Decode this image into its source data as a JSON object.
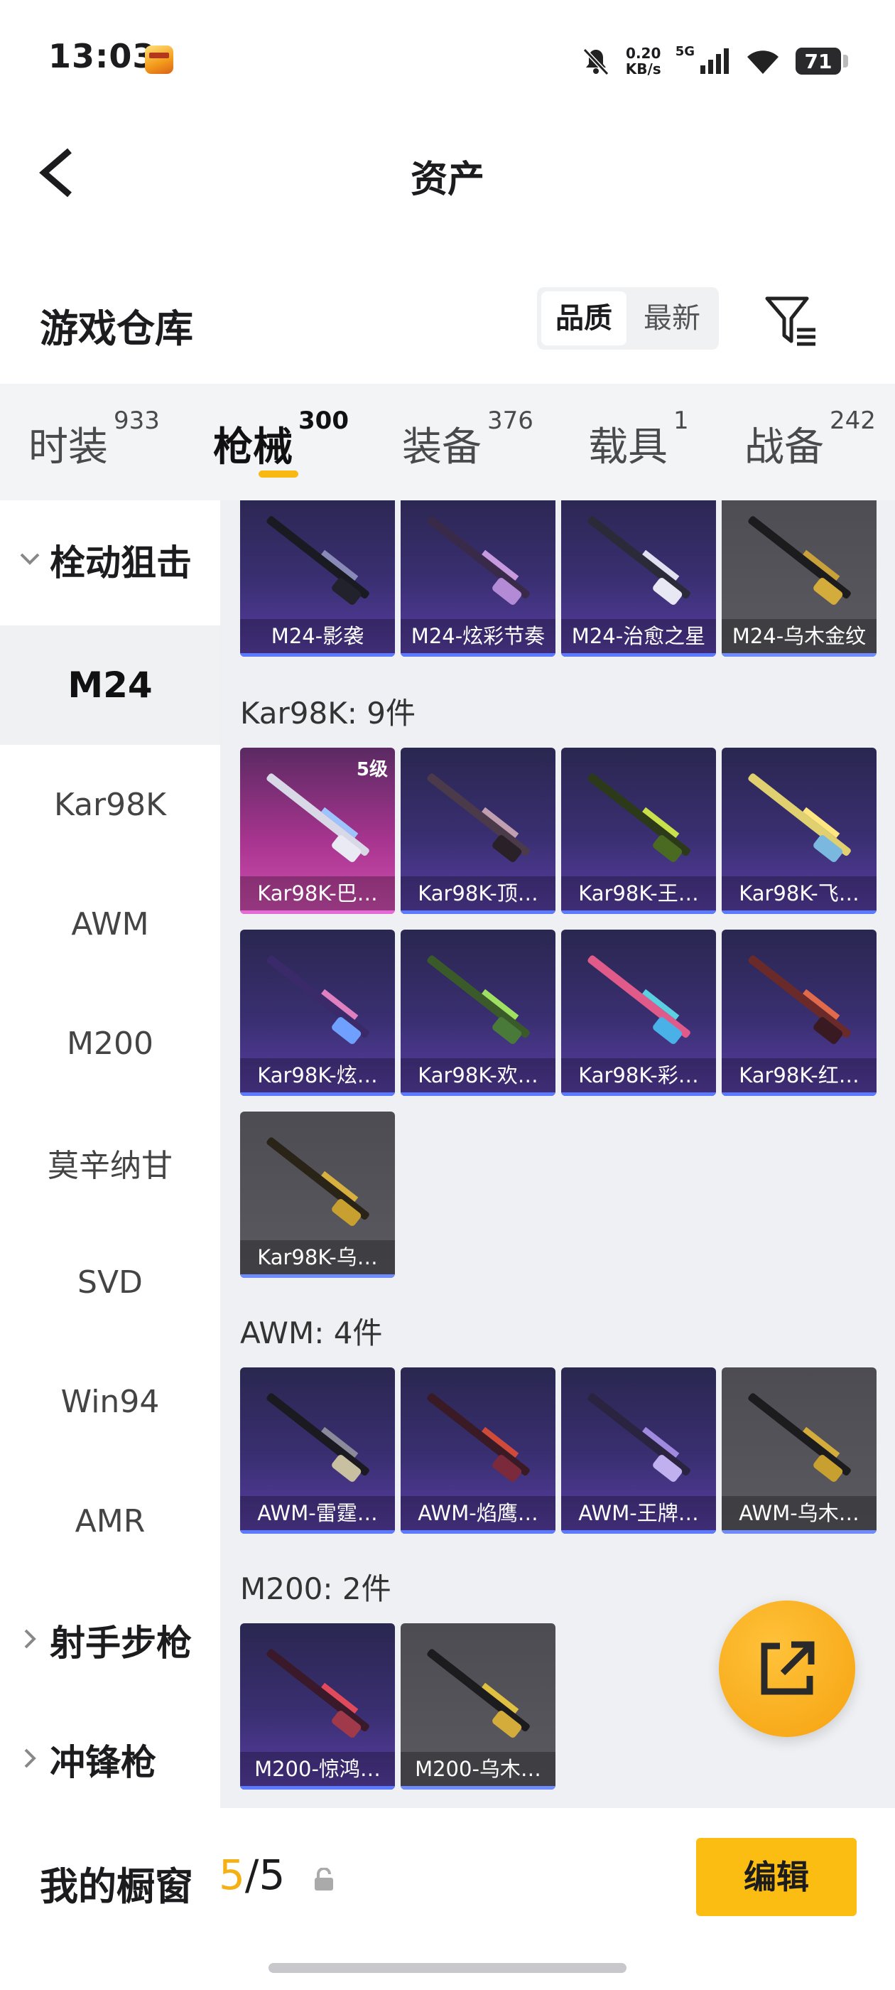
{
  "status_bar": {
    "time": "13:03",
    "net_speed_value": "0.20",
    "net_speed_unit": "KB/s",
    "signal": "5G",
    "battery": "71"
  },
  "nav": {
    "title": "资产"
  },
  "header": {
    "title": "游戏仓库",
    "sort_options": [
      "品质",
      "最新"
    ]
  },
  "category_tabs": [
    {
      "label": "时装",
      "count": "933"
    },
    {
      "label": "枪械",
      "count": "300"
    },
    {
      "label": "装备",
      "count": "376"
    },
    {
      "label": "载具",
      "count": "1"
    },
    {
      "label": "战备",
      "count": "242"
    }
  ],
  "sidebar": {
    "group_open": "栓动狙击",
    "items": [
      "M24",
      "Kar98K",
      "AWM",
      "M200",
      "莫辛纳甘",
      "SVD",
      "Win94",
      "AMR"
    ],
    "groups_collapsed": [
      "射手步枪",
      "冲锋枪"
    ]
  },
  "sections": {
    "m24": {
      "cards": [
        "M24-影袭",
        "M24-炫彩节奏",
        "M24-治愈之星",
        "M24-乌木金纹"
      ]
    },
    "kar98k": {
      "label": "Kar98K: 9件",
      "level_badge": "5级",
      "cards": [
        "Kar98K-巴…",
        "Kar98K-顶…",
        "Kar98K-王…",
        "Kar98K-飞…",
        "Kar98K-炫…",
        "Kar98K-欢…",
        "Kar98K-彩…",
        "Kar98K-红…",
        "Kar98K-乌…"
      ]
    },
    "awm": {
      "label": "AWM: 4件",
      "cards": [
        "AWM-雷霆…",
        "AWM-焰鹰…",
        "AWM-王牌…",
        "AWM-乌木…"
      ]
    },
    "m200": {
      "label": "M200: 2件",
      "cards": [
        "M200-惊鸿…",
        "M200-乌木…"
      ]
    }
  },
  "bottom": {
    "showcase_label": "我的橱窗",
    "showcase_current": "5",
    "showcase_sep": "/",
    "showcase_total": "5",
    "edit_label": "编辑"
  },
  "colors": {
    "accent": "#f8b914",
    "rare_card": "#3a2f72",
    "legend_card": "#a6348e",
    "gold_card": "#5a5a60"
  },
  "icons": [
    "back-arrow-icon",
    "filter-icon",
    "share-icon",
    "lock-icon",
    "chevron-down-icon",
    "chevron-right-icon"
  ]
}
